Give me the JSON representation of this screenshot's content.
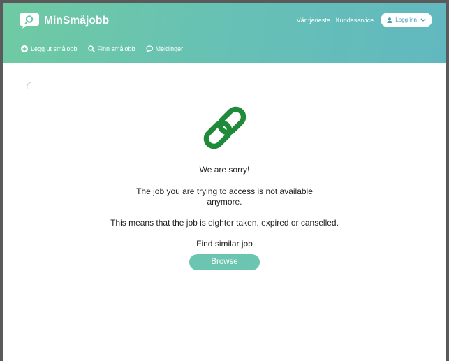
{
  "header": {
    "brand": "MinSmåjobb",
    "links": {
      "service": "Vår tjeneste",
      "support": "Kundeservice"
    },
    "login_label": "Logg inn",
    "nav": {
      "post_job": "Legg ut småjobb",
      "find_job": "Finn småjobb",
      "messages": "Meldinger"
    }
  },
  "main": {
    "icon": "link-chain-icon",
    "apology": "We are sorry!",
    "unavailable_line1": "The job you are trying to access is not available",
    "unavailable_line2": "anymore.",
    "reason": "This means that the job is eighter taken, expired or canselled.",
    "find_similar": "Find similar job",
    "browse_label": "Browse"
  },
  "colors": {
    "header_gradient_start": "#6fcaa3",
    "header_gradient_end": "#62b8bf",
    "chain_green": "#1e8a3a",
    "button_teal": "#6cc5b1"
  }
}
